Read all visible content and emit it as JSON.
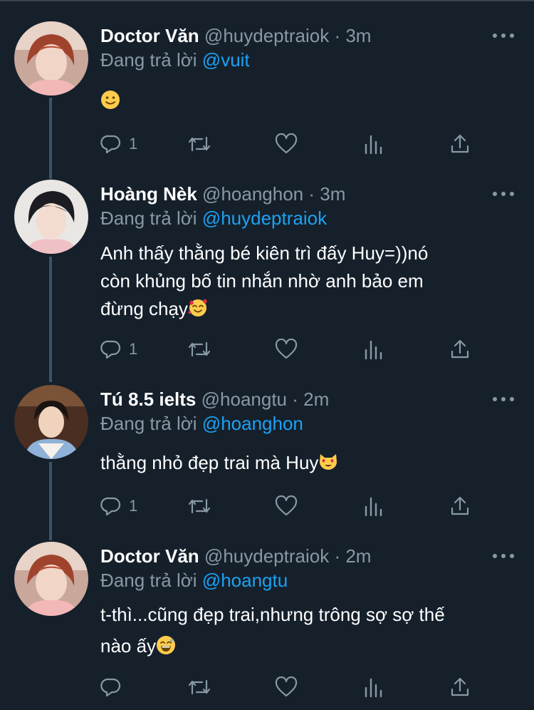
{
  "tweets": [
    {
      "name": "Doctor Văn",
      "handle": "@huydeptraiok",
      "time": "3m",
      "reply_prefix": "Đang trả lời",
      "reply_to": "@vuit",
      "text": "",
      "emoji": "slightly-smiling-face",
      "reply_count": "1"
    },
    {
      "name": "Hoàng Nèk",
      "handle": "@hoanghon",
      "time": "3m",
      "reply_prefix": "Đang trả lời",
      "reply_to": "@huydeptraiok",
      "text_lines": [
        "Anh thấy thằng bé kiên trì đấy Huy=))nó",
        "còn khủng bố tin nhắn nhờ anh bảo em",
        "đừng chạy"
      ],
      "emoji": "smiling-face-with-hearts",
      "reply_count": "1"
    },
    {
      "name": "Tú 8.5 ielts",
      "handle": "@hoangtu",
      "time": "2m",
      "reply_prefix": "Đang trả lời",
      "reply_to": "@hoanghon",
      "text": "thằng nhỏ đẹp trai mà Huy",
      "emoji": "heart-eyes-cat",
      "reply_count": "1"
    },
    {
      "name": "Doctor Văn",
      "handle": "@huydeptraiok",
      "time": "2m",
      "reply_prefix": "Đang trả lời",
      "reply_to": "@hoangtu",
      "text_lines": [
        "t-thì...cũng đẹp trai,nhưng trông sợ sợ thế",
        "nào ấy"
      ],
      "emoji": "grinning-sweat-face",
      "reply_count": ""
    }
  ],
  "separator": "·",
  "icons": [
    "reply-icon",
    "retweet-icon",
    "like-icon",
    "analytics-icon",
    "share-icon",
    "more-icon"
  ],
  "colors": {
    "background": "#15202b",
    "secondary_text": "#8899a6",
    "link": "#1da1f2",
    "connector": "#3d5466"
  }
}
